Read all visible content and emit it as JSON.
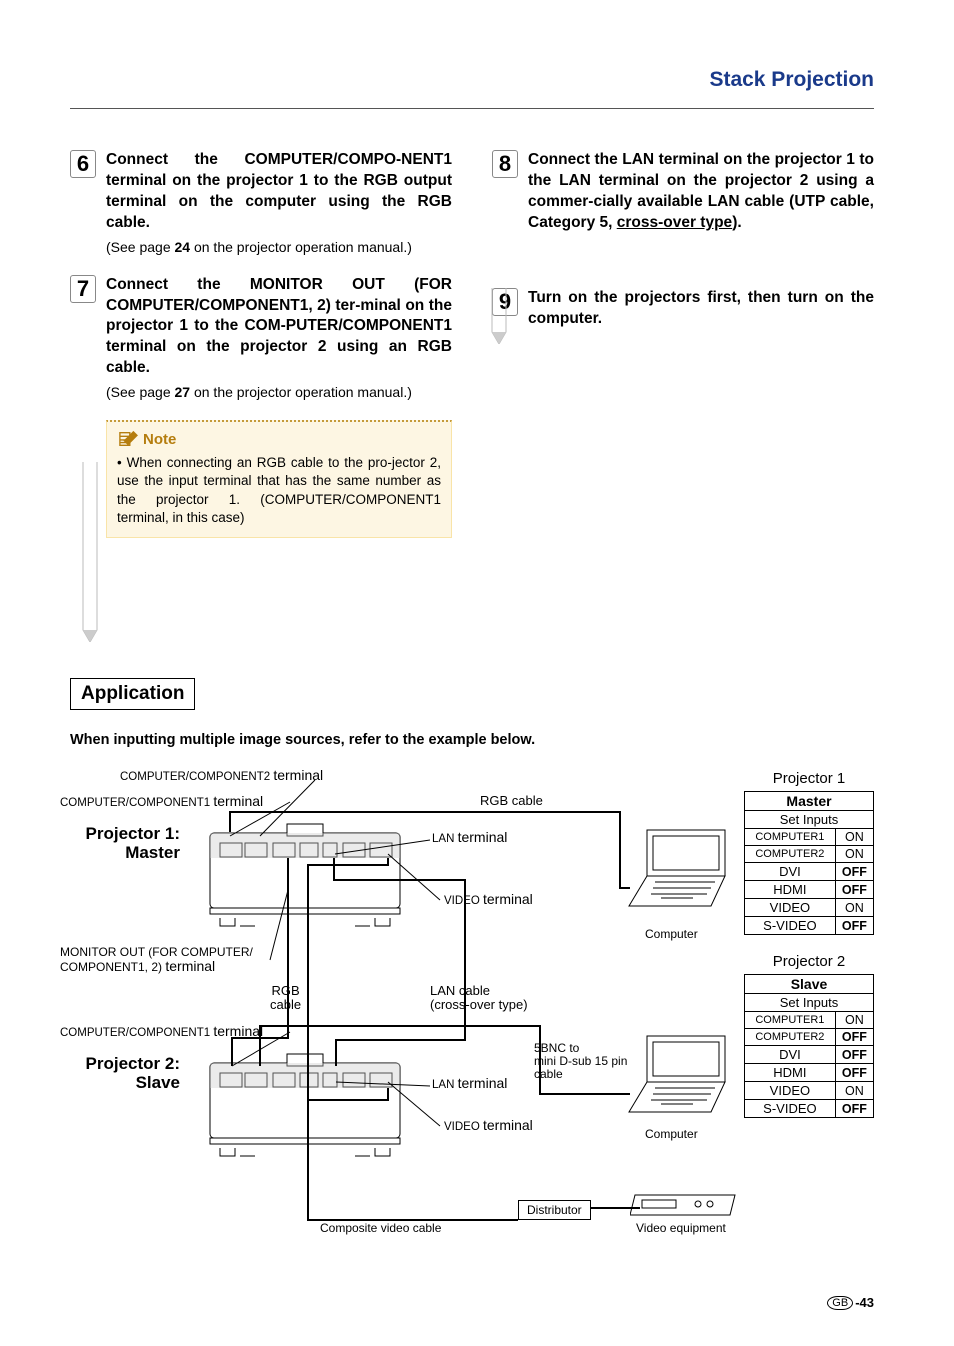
{
  "header": {
    "title": "Stack Projection"
  },
  "steps": {
    "s6": {
      "num": "6",
      "bold": "Connect the COMPUTER/COMPO-NENT1 terminal on the projector 1 to the RGB output terminal on the computer using the RGB cable.",
      "sub_a": "(See page ",
      "sub_page": "24",
      "sub_b": " on the projector operation manual.)"
    },
    "s7": {
      "num": "7",
      "bold": "Connect the MONITOR OUT (FOR COMPUTER/COMPONENT1, 2) ter-minal on the projector 1 to the COM-PUTER/COMPONENT1 terminal on the projector 2 using an RGB cable.",
      "sub_a": "(See page ",
      "sub_page": "27",
      "sub_b": " on the projector operation manual.)"
    },
    "s8": {
      "num": "8",
      "bold_a": "Connect the LAN terminal on the projector 1 to the LAN terminal on the projector 2 using a commer-cially available LAN cable (UTP cable, Category 5, ",
      "bold_under": "cross-over type",
      "bold_b": ")."
    },
    "s9": {
      "num": "9",
      "bold": "Turn on the projectors first, then turn on the computer."
    }
  },
  "note": {
    "label": "Note",
    "text": "• When connecting an RGB cable to the pro-jector 2, use the input terminal that has the same number as the projector 1. (COMPUTER/COMPONENT1 terminal, in this case)"
  },
  "application": {
    "heading": "Application",
    "caption": "When inputting multiple image sources, refer to the example below."
  },
  "diagram_labels": {
    "cc2_term_pre": "COMPUTER/COMPONENT2 ",
    "cc2_term_word": "terminal",
    "cc1_term_pre": "COMPUTER/COMPONENT1 ",
    "cc1_term_word": "terminal",
    "proj1_a": "Projector 1:",
    "proj1_b": "Master",
    "mon_out_a": "MONITOR OUT (FOR COMPUTER/",
    "mon_out_b_pre": "COMPONENT1, 2) ",
    "mon_out_b_word": "terminal",
    "rgb_cable_a": "RGB",
    "rgb_cable_b": "cable",
    "cc1_term2_pre": "COMPUTER/COMPONENT1 ",
    "cc1_term2_word": "terminal",
    "proj2_a": "Projector 2:",
    "proj2_b": "Slave",
    "rgb_cable_top": "RGB cable",
    "lan_term_pre": "LAN ",
    "lan_term_word": "terminal",
    "video_term_pre": "VIDEO ",
    "video_term_word": "terminal",
    "computer": "Computer",
    "lan_cable_a": "LAN cable",
    "lan_cable_b": "(cross-over type)",
    "bnc_a": "5BNC to",
    "bnc_b": "mini D-sub 15 pin",
    "bnc_c": "cable",
    "lan_term2_pre": "LAN ",
    "lan_term2_word": "terminal",
    "video_term2_pre": "VIDEO ",
    "video_term2_word": "terminal",
    "computer2": "Computer",
    "comp_video": "Composite video cable",
    "distributor": "Distributor",
    "video_eq": "Video equipment"
  },
  "tables": {
    "p1_caption": "Projector 1",
    "p2_caption": "Projector 2",
    "master": "Master",
    "slave": "Slave",
    "set_inputs": "Set Inputs",
    "p1_rows": [
      {
        "k": "COMPUTER1",
        "v": "ON",
        "bold": false
      },
      {
        "k": "COMPUTER2",
        "v": "ON",
        "bold": false
      },
      {
        "k": "DVI",
        "v": "OFF",
        "bold": true
      },
      {
        "k": "HDMI",
        "v": "OFF",
        "bold": true
      },
      {
        "k": "VIDEO",
        "v": "ON",
        "bold": false
      },
      {
        "k": "S-VIDEO",
        "v": "OFF",
        "bold": true
      }
    ],
    "p2_rows": [
      {
        "k": "COMPUTER1",
        "v": "ON",
        "bold": false
      },
      {
        "k": "COMPUTER2",
        "v": "OFF",
        "bold": true
      },
      {
        "k": "DVI",
        "v": "OFF",
        "bold": true
      },
      {
        "k": "HDMI",
        "v": "OFF",
        "bold": true
      },
      {
        "k": "VIDEO",
        "v": "ON",
        "bold": false
      },
      {
        "k": "S-VIDEO",
        "v": "OFF",
        "bold": true
      }
    ]
  },
  "footer": {
    "gb": "GB",
    "page": "-43"
  }
}
